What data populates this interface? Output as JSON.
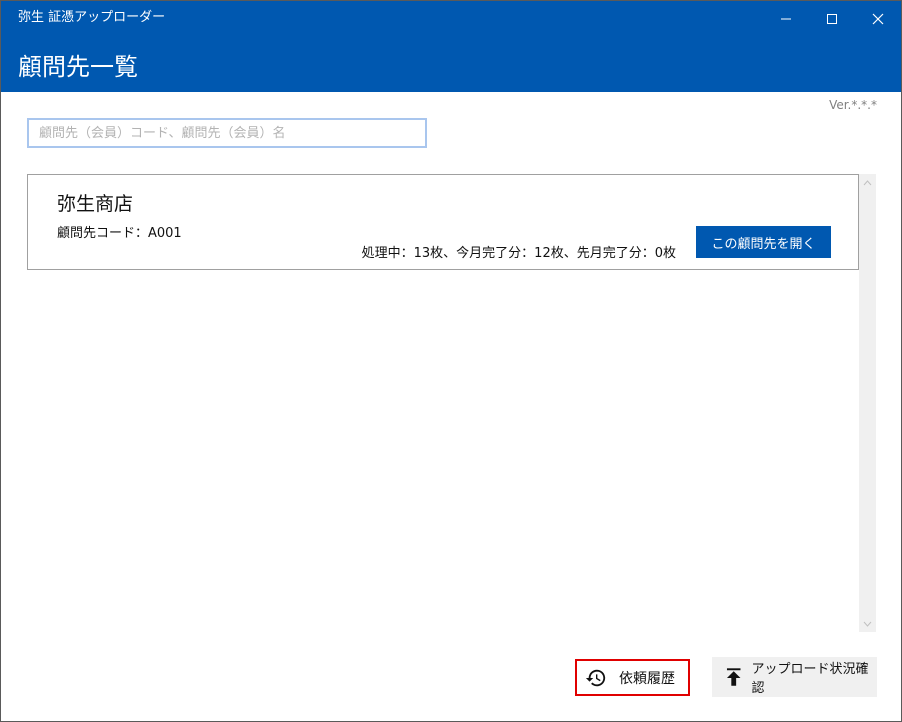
{
  "window": {
    "title": "弥生 証憑アップローダー",
    "controls": {
      "minimize": "—",
      "maximize": "☐",
      "close": "✕"
    }
  },
  "header": {
    "title": "顧問先一覧"
  },
  "version": "Ver.*.*.*",
  "search": {
    "placeholder": "顧問先（会員）コード、顧問先（会員）名",
    "value": ""
  },
  "clients": [
    {
      "name": "弥生商店",
      "code": "顧問先コード：A001",
      "status": "処理中：13枚、今月完了分：12枚、先月完了分：0枚",
      "open_label": "この顧問先を開く"
    }
  ],
  "footer": {
    "history_label": "依頼履歴",
    "history_icon": "history-icon",
    "upload_label": "アップロード状況確認",
    "upload_icon": "upload-icon"
  },
  "colors": {
    "brand": "#0058b0",
    "highlight": "#e00000"
  }
}
